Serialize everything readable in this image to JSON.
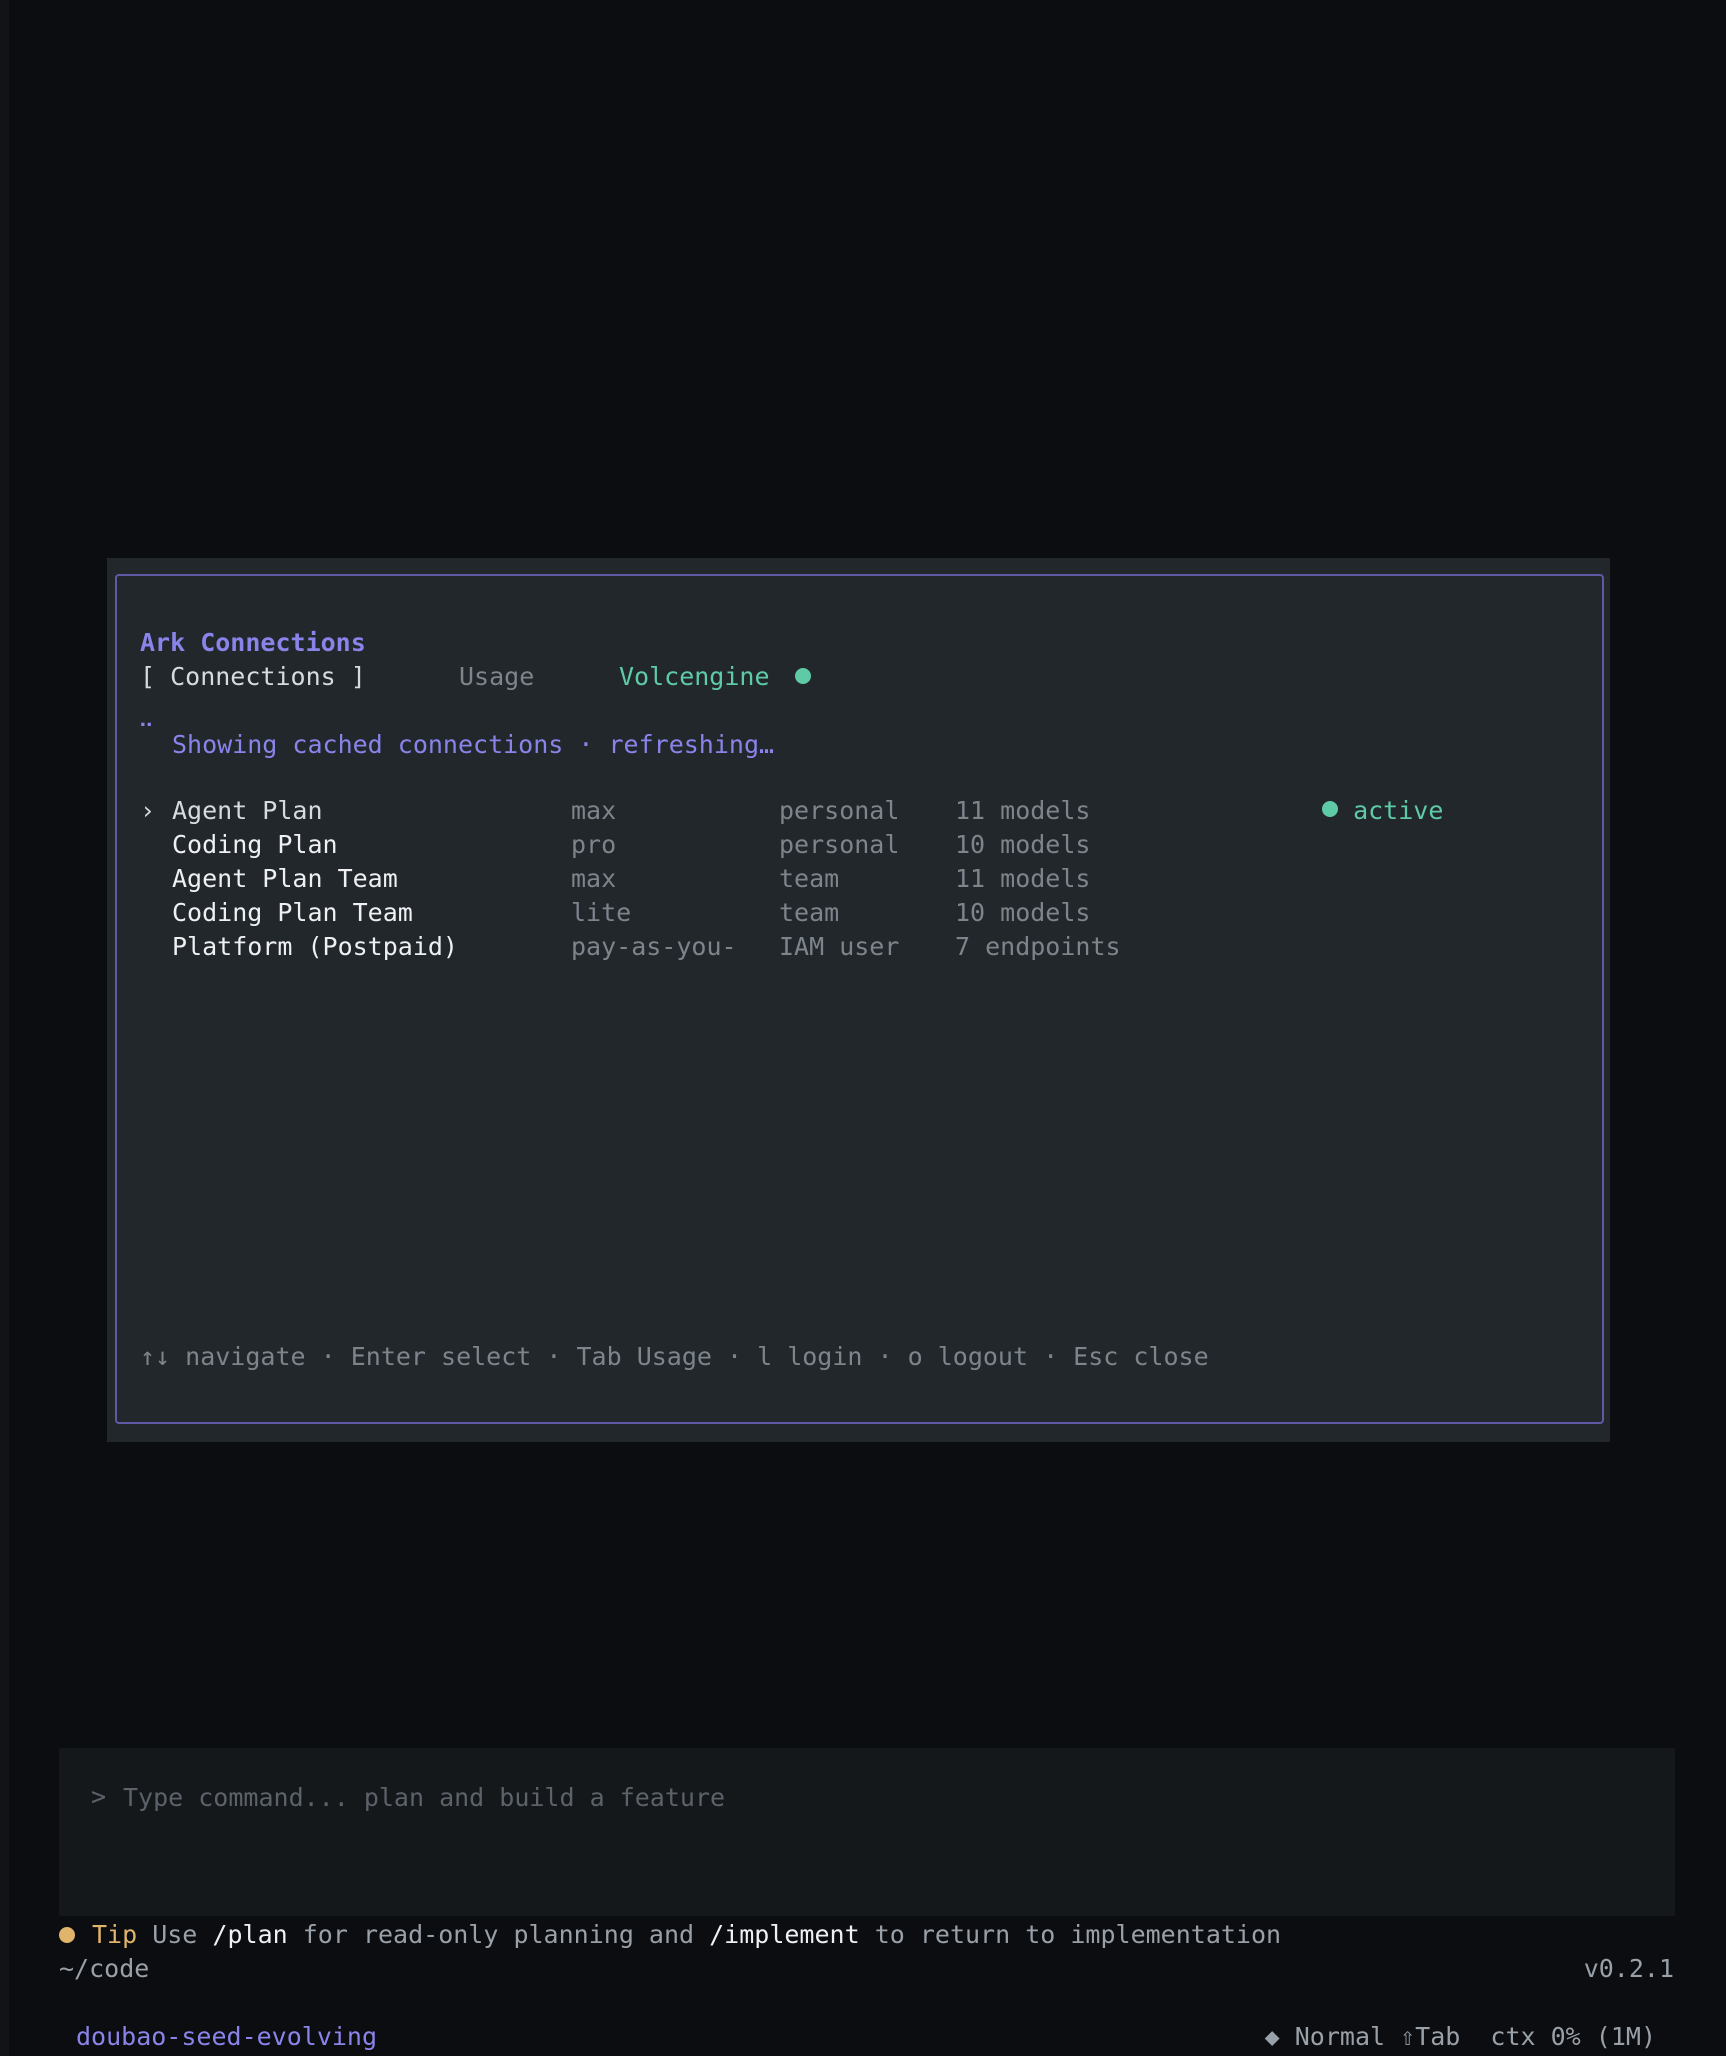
{
  "modal": {
    "title": "Ark Connections",
    "tabs": {
      "active": "[ Connections ]",
      "usage": "Usage",
      "provider": "Volcengine"
    },
    "status": {
      "spinner": "⠉",
      "message": "Showing cached connections · refreshing…"
    },
    "rows": [
      {
        "caret": "›",
        "name": "Agent Plan",
        "tier": "max",
        "scope": "personal",
        "count": "11 models",
        "state": "active"
      },
      {
        "caret": "",
        "name": "Coding Plan",
        "tier": "pro",
        "scope": "personal",
        "count": "10 models",
        "state": ""
      },
      {
        "caret": "",
        "name": "Agent Plan Team",
        "tier": "max",
        "scope": "team",
        "count": "11 models",
        "state": ""
      },
      {
        "caret": "",
        "name": "Coding Plan Team",
        "tier": "lite",
        "scope": "team",
        "count": "10 models",
        "state": ""
      },
      {
        "caret": "",
        "name": "Platform (Postpaid)",
        "tier": "pay-as-you-",
        "scope": "IAM user",
        "count": "7 endpoints",
        "state": ""
      }
    ],
    "help": "↑↓ navigate · Enter select · Tab Usage · l login · o logout · Esc close"
  },
  "input": {
    "prompt": ">",
    "placeholder": "Type command... plan and build a feature"
  },
  "tip": {
    "label": "Tip",
    "part1": " Use ",
    "cmd1": "/plan",
    "part2": " for read-only planning and ",
    "cmd2": "/implement",
    "part3": " to return to implementation"
  },
  "footer": {
    "cwd": "~/code",
    "version": "v0.2.1",
    "model": "doubao-seed-evolving",
    "mode": "◆ Normal ⇧Tab  ctx 0% (1M)"
  },
  "colors": {
    "accent": "#8a84ea",
    "success": "#5fcaa6",
    "warning": "#e0b46a",
    "background": "#0b0d10",
    "panel": "#22272c"
  }
}
